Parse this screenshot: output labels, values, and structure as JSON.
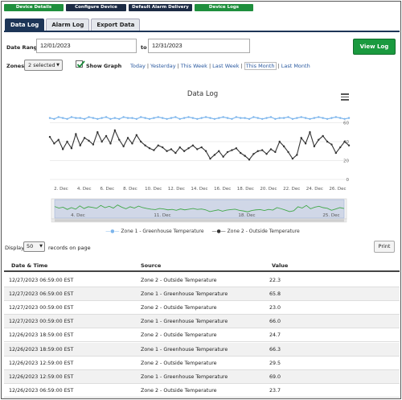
{
  "topnav": [
    {
      "label": "Device Details",
      "style": "green",
      "width": 74
    },
    {
      "label": "Configure Device",
      "style": "navy",
      "width": 75
    },
    {
      "label": "Default Alarm Delivery",
      "style": "navy",
      "width": 79
    },
    {
      "label": "Device Logs",
      "style": "green",
      "width": 73
    }
  ],
  "tabs": [
    {
      "label": "Data Log",
      "active": true
    },
    {
      "label": "Alarm Log",
      "active": false
    },
    {
      "label": "Export Data",
      "active": false
    }
  ],
  "filters": {
    "date_range_label": "Date Range",
    "start_date": "12/01/2023",
    "to_label": "to",
    "end_date": "12/31/2023",
    "view_log_label": "View Log",
    "zones_label": "Zones",
    "zones_value": "2 selected",
    "show_graph_label": "Show Graph",
    "show_graph_checked": true,
    "quick_ranges": [
      "Today",
      "Yesterday",
      "This Week",
      "Last Week",
      "This Month",
      "Last Month"
    ],
    "active_quick_range": "This Month"
  },
  "chart_data": {
    "type": "line",
    "title": "Data Log",
    "ylim": [
      0,
      80
    ],
    "y_ticks": [
      "0",
      "20",
      "40",
      "60"
    ],
    "x_ticks": [
      "2. Dec",
      "4. Dec",
      "6. Dec",
      "8. Dec",
      "10. Dec",
      "12. Dec",
      "14. Dec",
      "16. Dec",
      "18. Dec",
      "20. Dec",
      "22. Dec",
      "24. Dec",
      "26. Dec"
    ],
    "navigator_ticks": [
      "4. Dec",
      "11. Dec",
      "18. Dec",
      "25. Dec"
    ],
    "series": [
      {
        "name": "Zone 1 - Greenhouse Temperature",
        "color": "#7cb5ec",
        "values": [
          65,
          64,
          66,
          65,
          64,
          66,
          65,
          65,
          64,
          66,
          65,
          64,
          65,
          66,
          64,
          65,
          64,
          66,
          65,
          65,
          64,
          66,
          65,
          64,
          65,
          66,
          65,
          64,
          65,
          66,
          64,
          65,
          66,
          65,
          64,
          65,
          66,
          65,
          64,
          65,
          66,
          65,
          64,
          66,
          65,
          65,
          64,
          66,
          65,
          64,
          65,
          66,
          64,
          65,
          65,
          66,
          64,
          65,
          66,
          65,
          64,
          65,
          66,
          65,
          64,
          65,
          66,
          65,
          64,
          65
        ]
      },
      {
        "name": "Zone 2 - Outside Temperature",
        "color": "#333333",
        "values": [
          45,
          38,
          42,
          32,
          40,
          33,
          48,
          36,
          44,
          41,
          37,
          50,
          40,
          46,
          38,
          52,
          42,
          35,
          44,
          38,
          47,
          40,
          36,
          33,
          31,
          36,
          34,
          30,
          32,
          28,
          34,
          30,
          33,
          36,
          32,
          34,
          30,
          22,
          26,
          30,
          24,
          29,
          31,
          33,
          28,
          25,
          21,
          27,
          30,
          31,
          27,
          32,
          29,
          40,
          35,
          29,
          22,
          26,
          44,
          38,
          50,
          35,
          42,
          46,
          40,
          37,
          28,
          34,
          40,
          36
        ]
      }
    ],
    "legend_position": "bottom"
  },
  "display": {
    "display_label": "Display",
    "page_size": "50",
    "suffix_label": "records on page",
    "print_label": "Print"
  },
  "table": {
    "columns": [
      "Date & Time",
      "Source",
      "Value"
    ],
    "rows": [
      [
        "12/27/2023 06:59:00 EST",
        "Zone 2 - Outside Temperature",
        "22.3"
      ],
      [
        "12/27/2023 06:59:00 EST",
        "Zone 1 - Greenhouse Temperature",
        "65.8"
      ],
      [
        "12/27/2023 00:59:00 EST",
        "Zone 2 - Outside Temperature",
        "23.0"
      ],
      [
        "12/27/2023 00:59:00 EST",
        "Zone 1 - Greenhouse Temperature",
        "66.0"
      ],
      [
        "12/26/2023 18:59:00 EST",
        "Zone 2 - Outside Temperature",
        "24.7"
      ],
      [
        "12/26/2023 18:59:00 EST",
        "Zone 1 - Greenhouse Temperature",
        "66.3"
      ],
      [
        "12/26/2023 12:59:00 EST",
        "Zone 2 - Outside Temperature",
        "29.5"
      ],
      [
        "12/26/2023 12:59:00 EST",
        "Zone 1 - Greenhouse Temperature",
        "69.0"
      ],
      [
        "12/26/2023 06:59:00 EST",
        "Zone 2 - Outside Temperature",
        "23.7"
      ]
    ]
  }
}
